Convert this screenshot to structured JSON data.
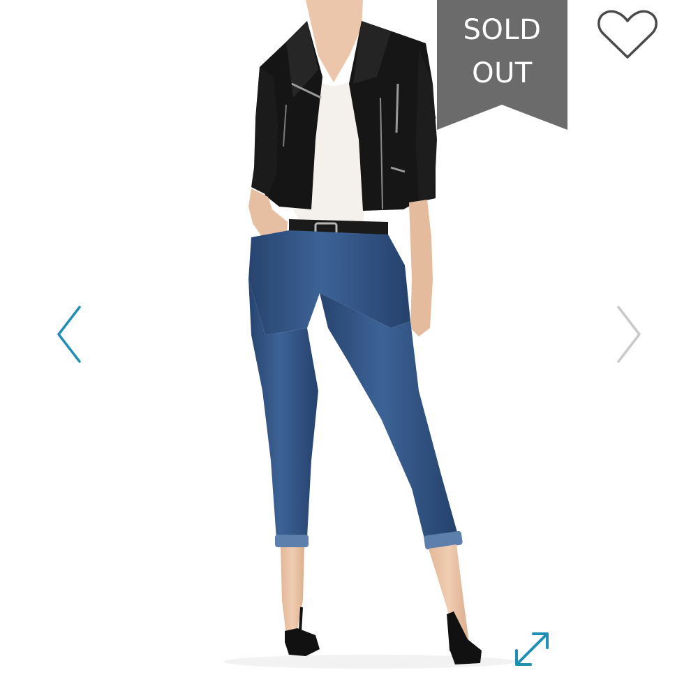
{
  "badge": {
    "line1": "SOLD",
    "line2": "OUT",
    "color": "#6b6b6b"
  },
  "icons": {
    "favorite": "heart-outline-icon",
    "previous": "chevron-left-icon",
    "next": "chevron-right-icon",
    "expand": "expand-diagonal-icon"
  },
  "colors": {
    "accent": "#1f8fb3",
    "badge_bg": "#6b6b6b",
    "heart_stroke": "#4a4a4a",
    "next_arrow": "#c9c9c9",
    "jacket": "#141414",
    "top": "#f4f1ec",
    "denim": "#2f4f80",
    "skin": "#e9c3a6"
  },
  "product": {
    "image": "model-wearing-black-leather-jacket-white-top-and-cropped-skinny-jeans"
  }
}
